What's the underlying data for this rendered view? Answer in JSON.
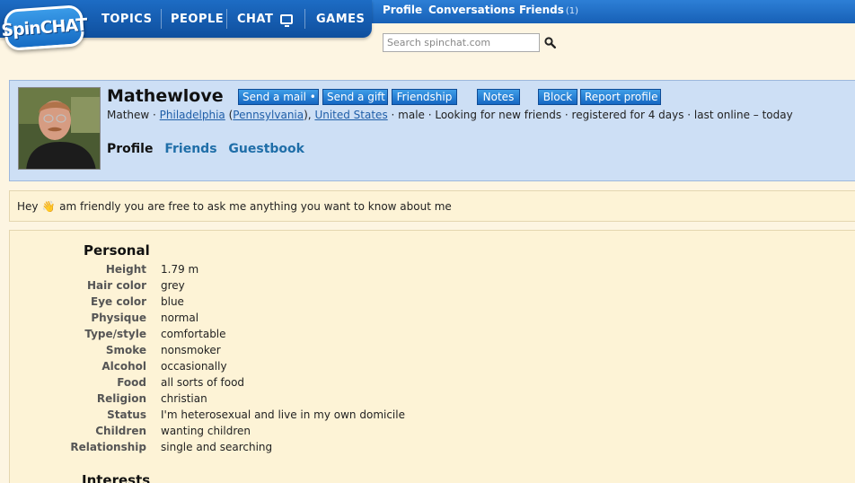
{
  "logo": {
    "text": "SpinCHAT"
  },
  "nav": {
    "topics": "TOPICS",
    "people": "PEOPLE",
    "chat": "CHAT",
    "games": "GAMES"
  },
  "top_links": {
    "profile": "Profile",
    "conversations": "Conversations",
    "friends": "Friends",
    "friends_count": "(1)"
  },
  "search": {
    "placeholder": "Search spinchat.com"
  },
  "profile": {
    "username": "Mathewlove",
    "buttons": {
      "send_mail": "Send a mail •",
      "send_gift": "Send a gift",
      "friendship": "Friendship",
      "notes": "Notes",
      "block": "Block",
      "report": "Report profile"
    },
    "meta": {
      "name": "Mathew",
      "sep1": " · ",
      "city": "Philadelphia",
      "state_open": " (",
      "state": "Pennsylvania",
      "state_close": "), ",
      "country": "United States",
      "rest": " · male · Looking for new friends · registered for 4 days · last online – today"
    },
    "tabs": {
      "profile": "Profile",
      "friends": "Friends",
      "guestbook": "Guestbook"
    }
  },
  "status_message": {
    "before": "Hey ",
    "emoji": "👋",
    "after": " am friendly you are free to ask me anything you want to know about me"
  },
  "personal": {
    "title": "Personal",
    "rows": [
      {
        "label": "Height",
        "value": "1.79 m"
      },
      {
        "label": "Hair color",
        "value": "grey"
      },
      {
        "label": "Eye color",
        "value": "blue"
      },
      {
        "label": "Physique",
        "value": "normal"
      },
      {
        "label": "Type/style",
        "value": "comfortable"
      },
      {
        "label": "Smoke",
        "value": "nonsmoker"
      },
      {
        "label": "Alcohol",
        "value": "occasionally"
      },
      {
        "label": "Food",
        "value": "all sorts of food"
      },
      {
        "label": "Religion",
        "value": "christian"
      },
      {
        "label": "Status",
        "value": "I'm heterosexual and live in my own domicile"
      },
      {
        "label": "Children",
        "value": "wanting children"
      },
      {
        "label": "Relationship",
        "value": "single and searching"
      }
    ]
  },
  "interests": {
    "title": "Interests"
  },
  "colors": {
    "nav_blue": "#1760b6",
    "header_bg": "#cddff5",
    "page_bg": "#fdf5e2",
    "button_blue": "#1567c2",
    "link_blue": "#1f5ea8"
  },
  "icons": {
    "chat": "monitor-icon",
    "search": "search-icon",
    "status": "waving-hand-icon"
  }
}
